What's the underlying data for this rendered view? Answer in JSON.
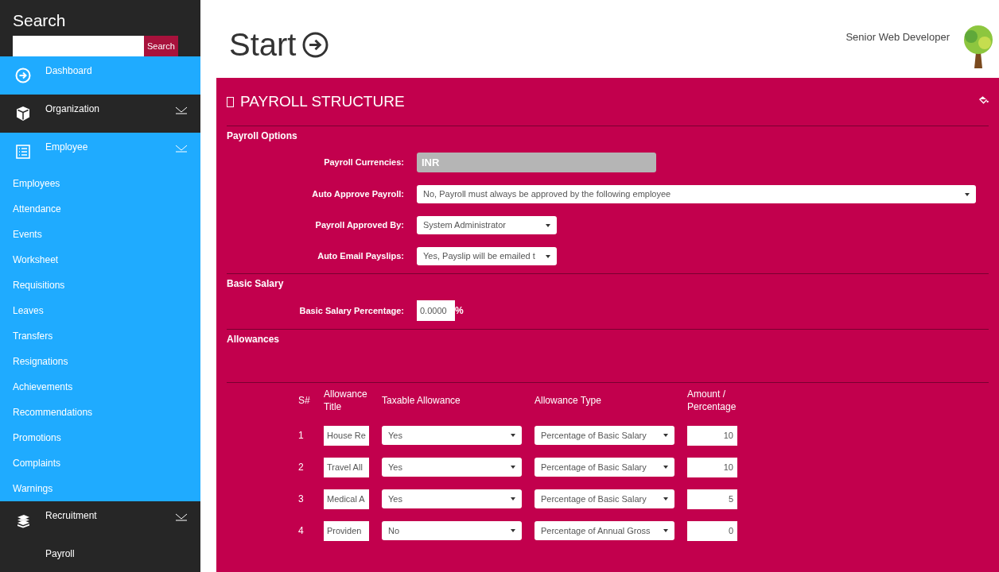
{
  "sidebar": {
    "search": {
      "title": "Search",
      "button": "Search"
    },
    "items": [
      {
        "label": "Dashboard",
        "kind": "arrow-circle",
        "active": true,
        "has_submenu": false
      },
      {
        "label": "Organization",
        "kind": "box",
        "active": false,
        "has_submenu": true
      },
      {
        "label": "Employee",
        "kind": "list",
        "active": true,
        "has_submenu": true,
        "children": [
          {
            "label": "Employees"
          },
          {
            "label": "Attendance"
          },
          {
            "label": "Events"
          },
          {
            "label": "Worksheet"
          },
          {
            "label": "Requisitions"
          },
          {
            "label": "Leaves"
          },
          {
            "label": "Transfers"
          },
          {
            "label": "Resignations"
          },
          {
            "label": "Achievements"
          },
          {
            "label": "Recommendations"
          },
          {
            "label": "Promotions"
          },
          {
            "label": "Complaints"
          },
          {
            "label": "Warnings"
          }
        ]
      },
      {
        "label": "Recruitment",
        "kind": "books",
        "active": false,
        "has_submenu": true
      },
      {
        "label": "Payroll",
        "kind": "plain",
        "active": false,
        "has_submenu": false
      }
    ]
  },
  "header": {
    "title": "Start",
    "user_role": "Senior Web Developer"
  },
  "panel": {
    "title": "PAYROLL STRUCTURE",
    "sections": [
      {
        "heading": "Payroll Options",
        "fields": [
          {
            "label": "Payroll Currencies:",
            "kind": "readonly",
            "value": "INR"
          },
          {
            "label": "Auto Approve Payroll:",
            "kind": "longselect",
            "value": "No, Payroll must always be approved by the following employee"
          },
          {
            "label": "Payroll Approved By:",
            "kind": "select",
            "value": "System Administrator"
          },
          {
            "label": "Auto Email Payslips:",
            "kind": "select",
            "value": "Yes, Payslip will be emailed t"
          }
        ]
      },
      {
        "heading": "Basic Salary",
        "fields": [
          {
            "label": "Basic Salary Percentage:",
            "kind": "percent",
            "value": "0.0000",
            "suffix": "%"
          }
        ]
      },
      {
        "heading": "Allowances"
      }
    ],
    "allowances": {
      "columns": [
        "S#",
        "Allowance Title",
        "Taxable Allowance",
        "Allowance Type",
        "Amount / Percentage"
      ],
      "rows": [
        {
          "n": "1",
          "title": "House Re",
          "taxable": "Yes",
          "type": "Percentage of Basic Salary",
          "amount": "10"
        },
        {
          "n": "2",
          "title": "Travel All",
          "taxable": "Yes",
          "type": "Percentage of Basic Salary",
          "amount": "10"
        },
        {
          "n": "3",
          "title": "Medical A",
          "taxable": "Yes",
          "type": "Percentage of Basic Salary",
          "amount": "5"
        },
        {
          "n": "4",
          "title": "Providen",
          "taxable": "No",
          "type": "Percentage of Annual Gross",
          "amount": "0"
        }
      ]
    }
  }
}
